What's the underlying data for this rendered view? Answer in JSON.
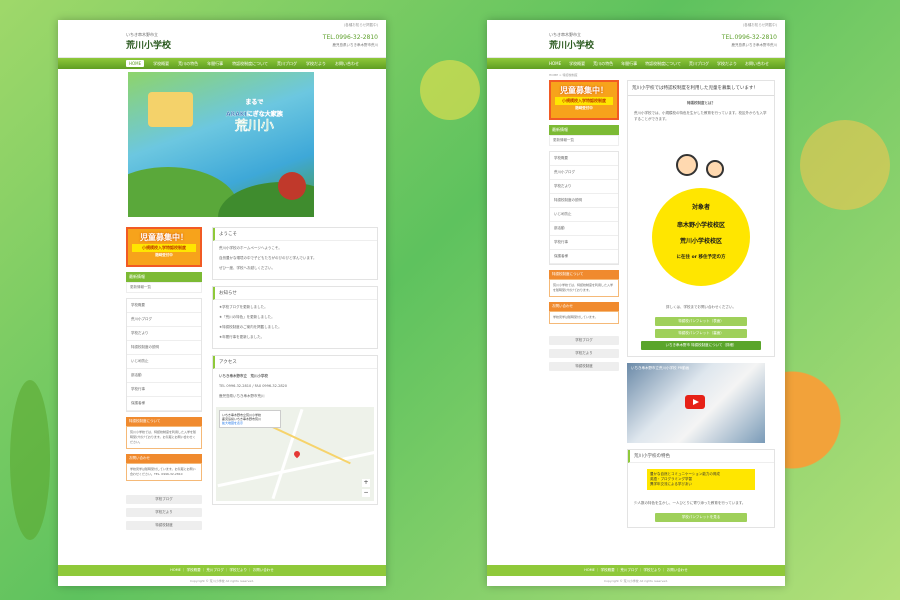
{
  "left": {
    "header": {
      "tagline": "いちき串木野市立",
      "title": "荒川小学校",
      "notice": "(各種お知らせ掲載中)",
      "tel": "TEL.0996-32-2810",
      "address": "鹿児島県いちき串木野市荒川"
    },
    "nav": [
      "HOME",
      "学校概要",
      "荒川の特色",
      "年間行事",
      "特認校制度について",
      "荒川ブログ",
      "学校だより",
      "お問い合わせ"
    ],
    "hero": {
      "line1": "まるで",
      "line2": "ARAKIにぎな大家族",
      "line3": "荒川小"
    },
    "recruit": {
      "big": "児童募集中！",
      "sub": "小規模校入学特認校制度",
      "note": "随時受付中"
    },
    "sidebar": {
      "box1_title": "最新情報",
      "box1_body": "更新情報一覧",
      "list": [
        "学校概要",
        "荒川小ブログ",
        "学校だより",
        "特認校制度の説明",
        "いじめ防止",
        "部活動",
        "学校行事",
        "保護者様"
      ],
      "orange1_title": "特認校制度について",
      "orange1_body": "荒川小学校では、特認校制度を利用した入学を随時受け付けております。お気軽にお問い合わせください。",
      "orange2_title": "お問い合わせ",
      "orange2_body": "学校見学は随時受付しています。お気軽にお問い合わせください。TEL. 0996-32-2810",
      "pager": [
        "学校ブログ",
        "学校だより",
        "特認校制度"
      ]
    },
    "welcome": {
      "title": "ようこそ",
      "lines": [
        "荒川小学校のホームページへようこそ。",
        "自然豊かな環境の中で子どもたちがのびのびと学んでいます。",
        "ぜひ一度、学校へお越しください。"
      ]
    },
    "news": {
      "title": "お知らせ",
      "items": [
        "★学校ブログを更新しました。",
        "★「荒川の特色」を更新しました。",
        "★特認校制度のご案内を掲載しました。",
        "★年間行事を更新しました。"
      ]
    },
    "access": {
      "title": "アクセス",
      "school": "いちき串木野市立　荒川小学校",
      "tel": "TEL 0996-32-2810 / FAX 0996-32-2820",
      "addr": "鹿児島県いちき串木野市荒川",
      "mapcard": "いちき串木野市立荒川小学校",
      "mapcard_sub": "鹿児島県いちき串木野市荒川",
      "mapcard_link": "拡大地図を表示"
    },
    "footer": {
      "links": "HOME ｜ 学校概要 ｜ 荒川ブログ ｜ 学校だより ｜ お問い合わせ",
      "copy": "Copyright © 荒川小学校 All rights reserved."
    }
  },
  "right": {
    "header": {
      "tagline": "いちき串木野市立",
      "title": "荒川小学校",
      "notice": "(各種お知らせ掲載中)",
      "tel": "TEL.0996-32-2810",
      "address": "鹿児島県いちき串木野市荒川"
    },
    "nav": [
      "HOME",
      "学校概要",
      "荒川の特色",
      "年間行事",
      "特認校制度について",
      "荒川ブログ",
      "学校だより",
      "お問い合わせ"
    ],
    "breadcrumb": "HOME > 特認校制度",
    "recruit": {
      "big": "児童募集中！",
      "sub": "小規模校入学特認校制度",
      "note": "随時受付中"
    },
    "sidebar": {
      "box1_title": "最新情報",
      "box1_body": "更新情報一覧",
      "list": [
        "学校概要",
        "荒川小ブログ",
        "学校だより",
        "特認校制度の説明",
        "いじめ防止",
        "部活動",
        "学校行事",
        "保護者様"
      ],
      "orange1_title": "特認校制度について",
      "orange1_body": "荒川小学校では、特認校制度を利用した入学を随時受け付けております。",
      "orange2_title": "お問い合わせ",
      "orange2_body": "学校見学は随時受付しています。",
      "pager": [
        "学校ブログ",
        "学校だより",
        "特認校制度"
      ]
    },
    "article": {
      "title": "荒川小学校では特認校制度を利用した児童を募集しています！",
      "intro": "特認校制度とは？",
      "body": "荒川小学校では、小規模校の特色を生かした教育を行っています。校区外からも入学することができます。",
      "poster_target": "対象者",
      "poster_area1": "串木野小学校校区",
      "poster_area2": "荒川小学校校区",
      "poster_cond": "に在住 or 移住予定の方",
      "after": "詳しくは、学校までお問い合わせください。",
      "btn1": "特認校パンフレット（表面）",
      "btn2": "特認校パンフレット（裏面）",
      "btn3": "いちき串木野市 特認校制度について（詳細）"
    },
    "video": {
      "title": "いちき串木野市立荒川小学校 PR動画"
    },
    "features": {
      "title": "荒川小学校の特色",
      "box": "豊かな自然とコミュニケーション能力の育成\n英語・プログラミング学習\n異学年交流による学びあい",
      "text": "少人数の特色を生かし、一人ひとりに寄り添った教育を行っています。",
      "btn": "学校パンフレットを見る"
    },
    "footer": {
      "links": "HOME ｜ 学校概要 ｜ 荒川ブログ ｜ 学校だより ｜ お問い合わせ",
      "copy": "Copyright © 荒川小学校 All rights reserved."
    }
  }
}
